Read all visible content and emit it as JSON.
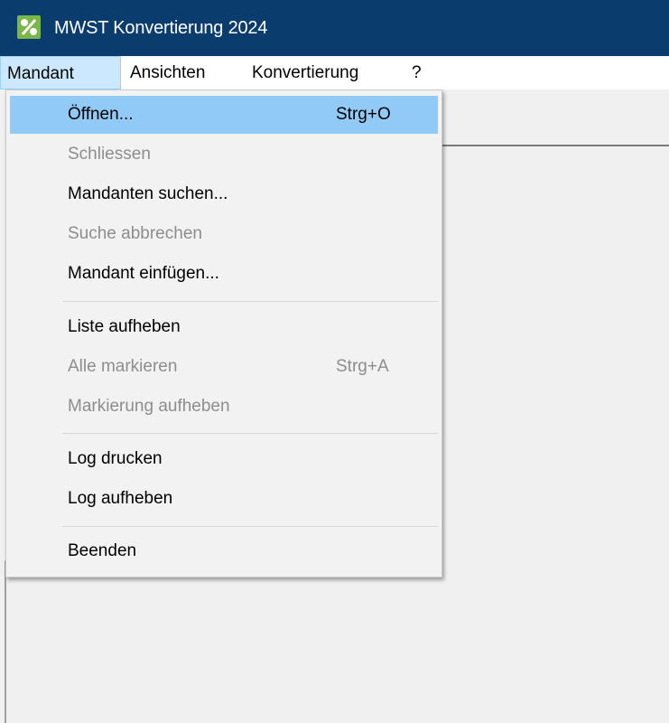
{
  "window": {
    "title": "MWST Konvertierung 2024",
    "app_icon": "percent-icon"
  },
  "menubar": {
    "items": [
      {
        "label": "Mandant"
      },
      {
        "label": "Ansichten"
      },
      {
        "label": "Konvertierung"
      },
      {
        "label": "?"
      }
    ]
  },
  "menu": {
    "items": [
      {
        "label": "Öffnen...",
        "shortcut": "Strg+O",
        "state": "highlighted"
      },
      {
        "label": "Schliessen",
        "shortcut": "",
        "state": "disabled"
      },
      {
        "label": "Mandanten suchen...",
        "shortcut": "",
        "state": "enabled"
      },
      {
        "label": "Suche abbrechen",
        "shortcut": "",
        "state": "disabled"
      },
      {
        "label": "Mandant einfügen...",
        "shortcut": "",
        "state": "enabled"
      },
      {
        "label": "Liste aufheben",
        "shortcut": "",
        "state": "enabled"
      },
      {
        "label": "Alle markieren",
        "shortcut": "Strg+A",
        "state": "disabled"
      },
      {
        "label": "Markierung aufheben",
        "shortcut": "",
        "state": "disabled"
      },
      {
        "label": "Log drucken",
        "shortcut": "",
        "state": "enabled"
      },
      {
        "label": "Log aufheben",
        "shortcut": "",
        "state": "enabled"
      },
      {
        "label": "Beenden",
        "shortcut": "",
        "state": "enabled"
      }
    ]
  },
  "colors": {
    "titlebar": "#0a3d6e",
    "highlight": "#91c9f7",
    "menubar_active": "#cce8ff",
    "disabled_text": "#8d8d8d"
  }
}
